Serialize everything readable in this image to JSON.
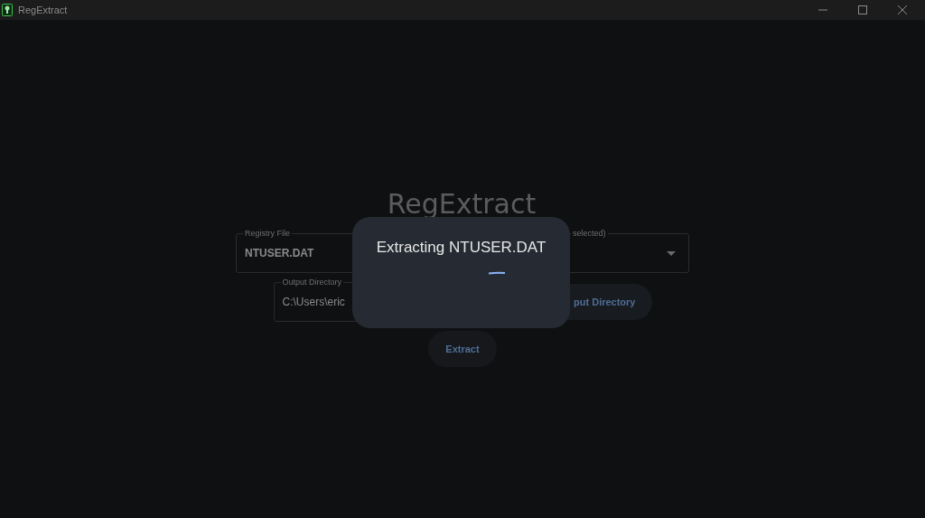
{
  "window": {
    "title": "RegExtract"
  },
  "heading": "RegExtract",
  "registry_file": {
    "label": "Registry File",
    "value": "NTUSER.DAT"
  },
  "hive_select": {
    "label": "selected)"
  },
  "output_directory": {
    "label": "Output Directory",
    "value": "C:\\Users\\eric"
  },
  "buttons": {
    "browse_output": "put Directory",
    "extract": "Extract"
  },
  "dialog": {
    "message": "Extracting NTUSER.DAT"
  }
}
